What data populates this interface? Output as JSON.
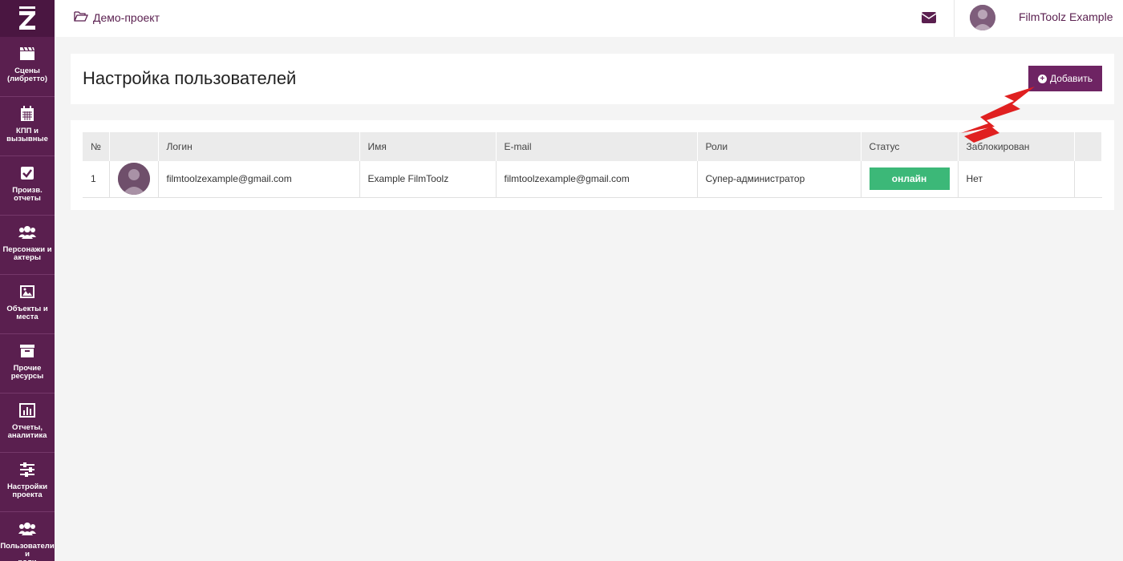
{
  "sidebar": {
    "logo": "Z",
    "items": [
      {
        "label": "Сцены\n(либретто)",
        "icon": "clapperboard-icon"
      },
      {
        "label": "КПП и\nвызывные",
        "icon": "calendar-icon"
      },
      {
        "label": "Произв.\nотчеты",
        "icon": "checkbox-icon"
      },
      {
        "label": "Персонажи и\nактеры",
        "icon": "users-icon"
      },
      {
        "label": "Объекты и\nместа",
        "icon": "image-icon"
      },
      {
        "label": "Прочие\nресурсы",
        "icon": "archive-icon"
      },
      {
        "label": "Отчеты,\nаналитика",
        "icon": "bar-chart-icon"
      },
      {
        "label": "Настройки\nпроекта",
        "icon": "sliders-icon"
      },
      {
        "label": "Пользователи и\nроли",
        "icon": "users-icon"
      }
    ]
  },
  "topbar": {
    "project": "Демо-проект",
    "user_name": "FilmToolz Example"
  },
  "page": {
    "title": "Настройка пользователей",
    "add_label": "Добавить"
  },
  "table": {
    "headers": [
      "№",
      "",
      "Логин",
      "Имя",
      "E-mail",
      "Роли",
      "Статус",
      "Заблокирован"
    ],
    "rows": [
      {
        "num": "1",
        "login": "filmtoolzexample@gmail.com",
        "name": "Example FilmToolz",
        "email": "filmtoolzexample@gmail.com",
        "roles": "Супер-администратор",
        "status": "онлайн",
        "blocked": "Нет"
      }
    ]
  },
  "colors": {
    "sidebar": "#5a1f4f",
    "accent": "#6e2463",
    "status_online": "#3cb878",
    "annotation_arrow": "#e02020"
  }
}
